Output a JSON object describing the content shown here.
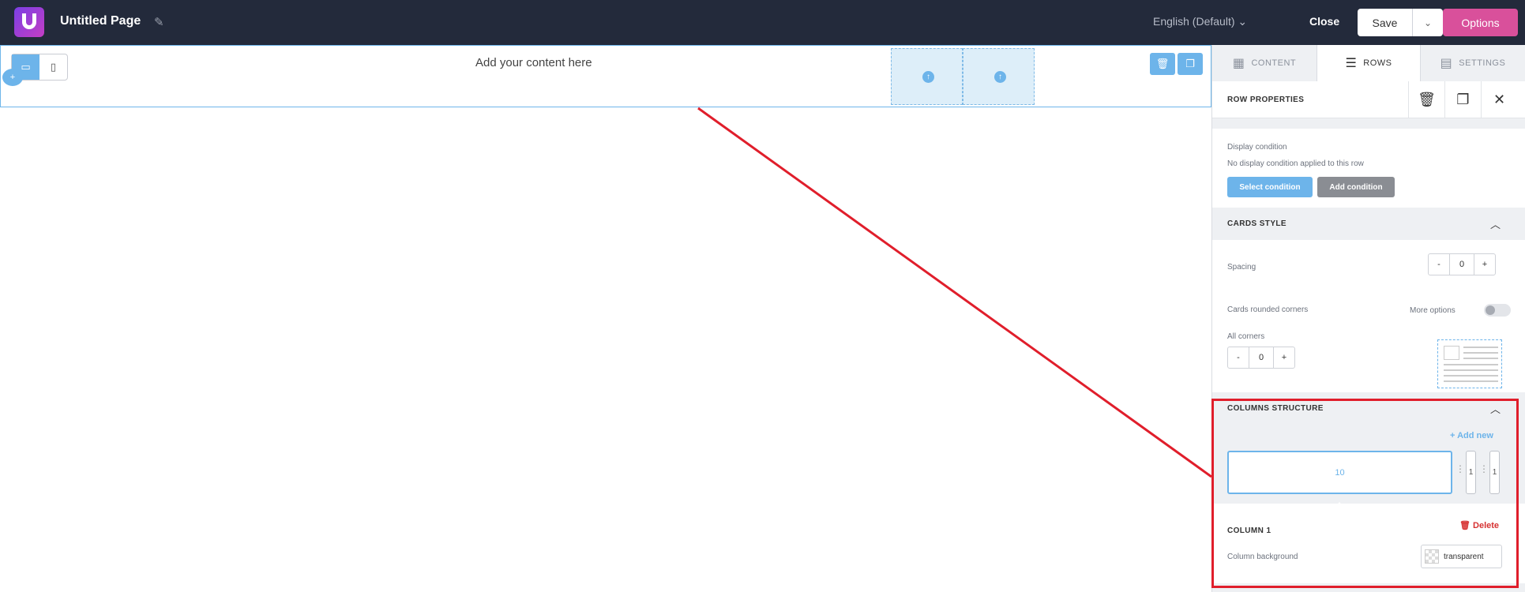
{
  "topbar": {
    "title": "Untitled Page",
    "language": "English (Default) ⌄",
    "close_label": "Close",
    "save_label": "Save",
    "options_label": "Options"
  },
  "canvas": {
    "placeholder_text": "Add your content here"
  },
  "panel": {
    "tabs": [
      {
        "label": "CONTENT",
        "icon": "grid-icon"
      },
      {
        "label": "ROWS",
        "icon": "rows-icon"
      },
      {
        "label": "SETTINGS",
        "icon": "settings-list-icon"
      }
    ],
    "header_title": "ROW PROPERTIES",
    "display_condition": {
      "label": "Display condition",
      "status": "No display condition applied to this row",
      "select_label": "Select condition",
      "add_label": "Add condition"
    },
    "cards_style": {
      "title": "CARDS STYLE",
      "spacing_label": "Spacing",
      "spacing_value": "0",
      "rounded_label": "Cards rounded corners",
      "more_options_label": "More options",
      "all_corners_label": "All corners",
      "corners_value": "0"
    },
    "columns_structure": {
      "title": "COLUMNS STRUCTURE",
      "add_new_label": "+  Add new",
      "columns": [
        "10",
        "1",
        "1"
      ]
    },
    "column": {
      "title": "COLUMN 1",
      "delete_label": "Delete",
      "background_label": "Column background",
      "background_value": "transparent"
    }
  },
  "colors": {
    "topbar": "#232a3b",
    "accent": "#6db4ea",
    "options": "#d9509b",
    "highlight": "#e01e2b"
  }
}
